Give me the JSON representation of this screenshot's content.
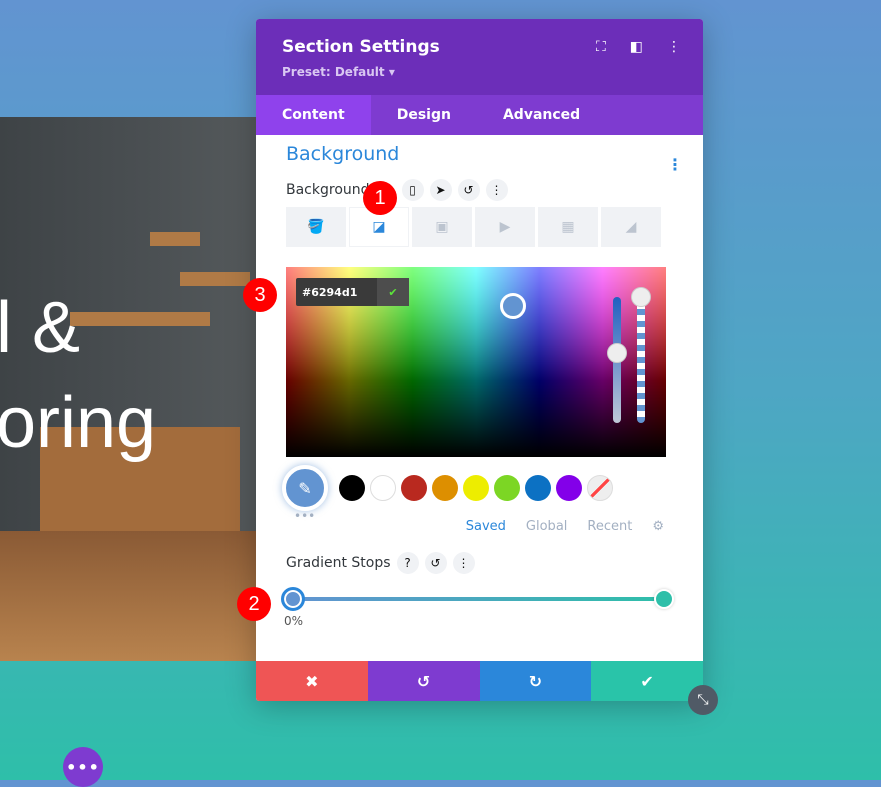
{
  "hero": {
    "line1": "l &",
    "line2": "oring"
  },
  "modal": {
    "title": "Section Settings",
    "preset": "Preset: Default ▾",
    "tabs": [
      {
        "label": "Content",
        "active": true
      },
      {
        "label": "Design"
      },
      {
        "label": "Advanced"
      }
    ],
    "section_title": "Background",
    "field_label": "Background",
    "color": {
      "hex": "#6294d1"
    },
    "swatches": [
      "#000000",
      "#ffffff",
      "#b9291f",
      "#dd8f00",
      "#eded00",
      "#7cd624",
      "#0c71c3",
      "#8300e9"
    ],
    "palette_tabs": {
      "saved": "Saved",
      "global": "Global",
      "recent": "Recent"
    },
    "gradient_label": "Gradient Stops",
    "stops": [
      {
        "color": "#6294d1",
        "position": "0%"
      },
      {
        "color": "#2ebfa9",
        "position": "100%"
      }
    ]
  },
  "badges": [
    "1",
    "2",
    "3"
  ]
}
